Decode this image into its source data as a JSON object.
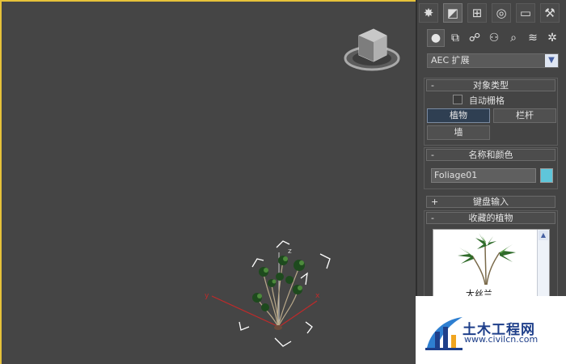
{
  "panel": {
    "tabs": [
      "create",
      "modify",
      "hierarchy",
      "motion",
      "display",
      "utilities"
    ],
    "subtabs": [
      "geometry",
      "shapes",
      "lights",
      "cameras",
      "helpers",
      "space-warps",
      "systems"
    ],
    "category_dropdown": "AEC 扩展",
    "object_type": {
      "title": "对象类型",
      "autogrid_label": "自动栅格",
      "buttons": [
        "植物",
        "栏杆",
        "墙"
      ]
    },
    "name_color": {
      "title": "名称和颜色",
      "name_value": "Foliage01",
      "color": "#5fc6da"
    },
    "keyboard_entry": {
      "title": "键盘输入"
    },
    "favorite_plants": {
      "title": "收藏的植物",
      "plant_name": "大丝兰"
    }
  },
  "viewport": {
    "axis_x": "x",
    "axis_y": "y",
    "axis_z": "z"
  },
  "watermark": {
    "title": "土木工程网",
    "url": "www.civilcn.com"
  }
}
